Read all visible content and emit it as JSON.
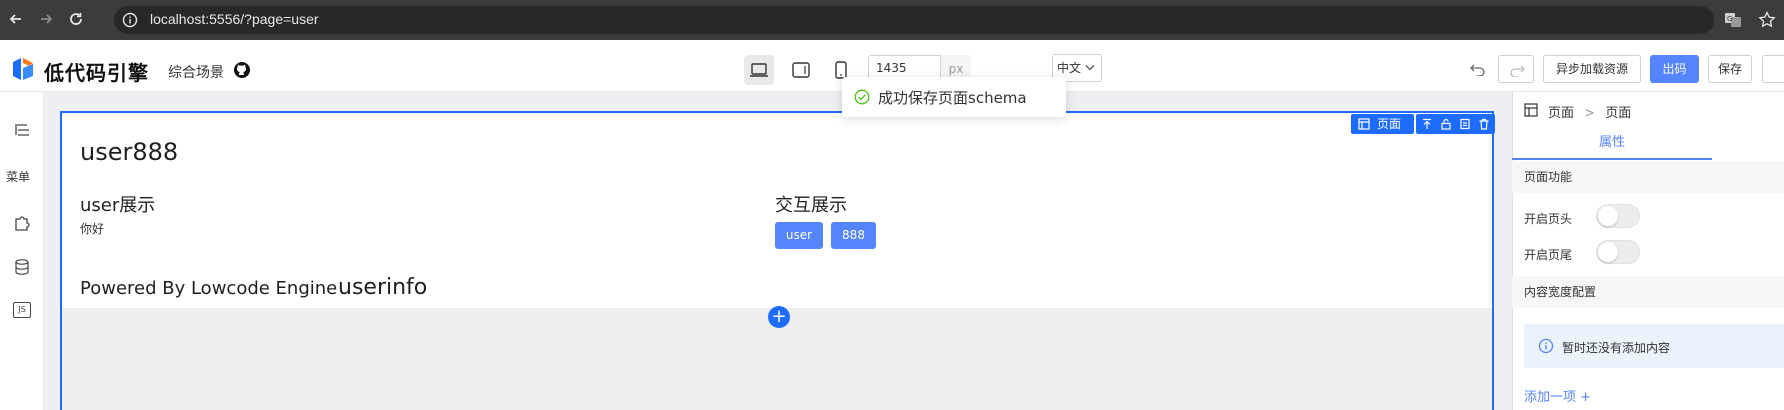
{
  "browser": {
    "url": "localhost:5556/?page=user"
  },
  "toolbar": {
    "brand": "低代码引擎",
    "scene": "综合场景",
    "canvas_width": "1435",
    "width_unit": "px",
    "language": "中文",
    "async_load_label": "异步加载资源",
    "code_label": "出码",
    "save_label": "保存"
  },
  "toast": {
    "message": "成功保存页面schema",
    "status_color": "#52c41a"
  },
  "left_rail": {
    "menu_label": "菜单",
    "js_label": "JS"
  },
  "canvas": {
    "title": "user888",
    "left_heading": "user展示",
    "left_text": "你好",
    "right_heading": "交互展示",
    "buttons": [
      "user",
      "888"
    ],
    "powered": "Powered By Lowcode Engine",
    "userinfo": "userinfo",
    "selection_label": "页面",
    "accent_color": "#1e6cff"
  },
  "panel": {
    "breadcrumb_root": "页面",
    "breadcrumb_sep": ">",
    "breadcrumb_current": "页面",
    "tab_label": "属性",
    "section_page_features": "页面功能",
    "enable_header_label": "开启页头",
    "enable_footer_label": "开启页尾",
    "enable_header": false,
    "enable_footer": false,
    "section_content_width": "内容宽度配置",
    "empty_notice": "暂时还没有添加内容",
    "add_item_label": "添加一项 +"
  }
}
